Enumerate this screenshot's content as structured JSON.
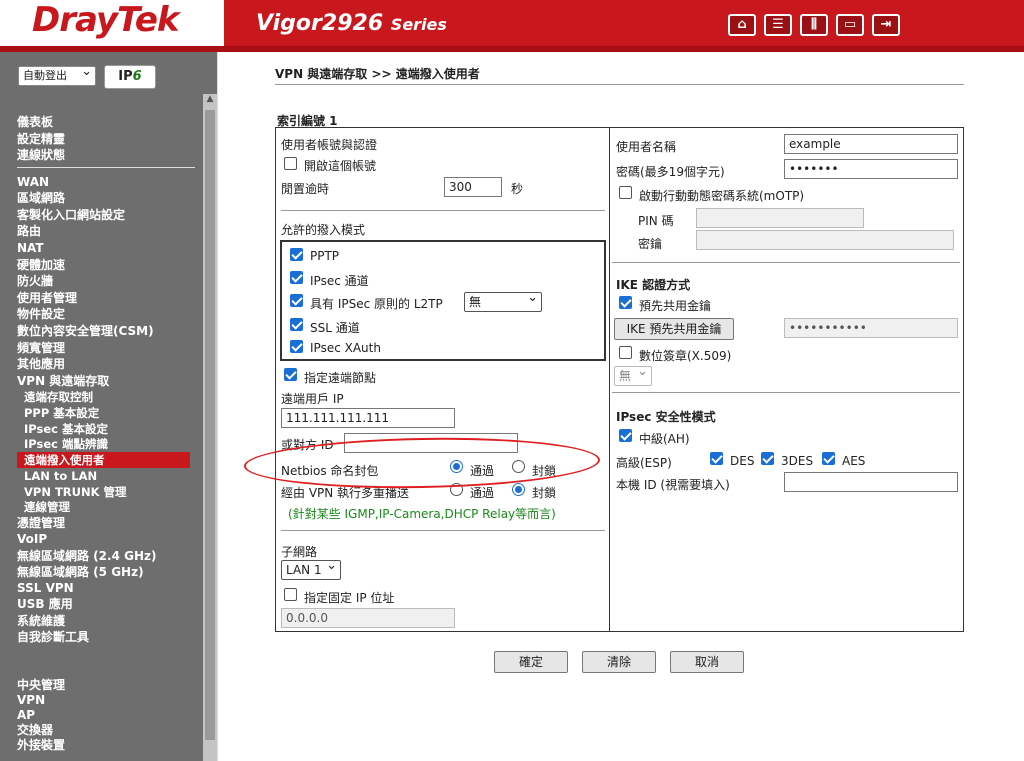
{
  "header": {
    "logo": "DrayTek",
    "model_main": "Vigor2926",
    "model_suffix": "Series",
    "icons": [
      "home-icon",
      "list-icon",
      "sliders-icon",
      "save-icon",
      "logout-icon"
    ]
  },
  "sidebar": {
    "logout_select": "自動登出",
    "ipv6_badge_prefix": "IP",
    "ipv6_badge_suffix": "6",
    "group1": [
      "儀表板",
      "設定精靈",
      "連線狀態"
    ],
    "group2": [
      "WAN",
      "區域網路",
      "客製化入口網站設定",
      "路由",
      "NAT",
      "硬體加速",
      "防火牆",
      "使用者管理",
      "物件設定",
      "數位內容安全管理(CSM)",
      "頻寬管理",
      "其他應用",
      "VPN 與遠端存取"
    ],
    "vpn_sub": [
      "遠端存取控制",
      "PPP 基本設定",
      "IPsec 基本設定",
      "IPsec 端點辨識",
      "遠端撥入使用者",
      "LAN to LAN",
      "VPN TRUNK 管理",
      "連線管理"
    ],
    "group3": [
      "憑證管理",
      "VoIP",
      "無線區域網路 (2.4 GHz)",
      "無線區域網路 (5 GHz)",
      "SSL VPN",
      "USB 應用",
      "系統維護",
      "自我診斷工具"
    ],
    "group4": [
      "中央管理",
      "VPN",
      "AP",
      "交換器",
      "外接裝置"
    ]
  },
  "breadcrumb": "VPN 與遠端存取 >> 遠端撥入使用者",
  "index_title": "索引編號 1",
  "left": {
    "account_section": "使用者帳號與認證",
    "enable_account": "開啟這個帳號",
    "idle_timeout_label": "閒置逾時",
    "idle_timeout_value": "300",
    "idle_timeout_unit": "秒",
    "allowed_modes_title": "允許的撥入模式",
    "mode_pptp": "PPTP",
    "mode_ipsec": "IPsec 通道",
    "mode_l2tp": "具有 IPSec 原則的 L2TP",
    "l2tp_policy": "無",
    "mode_ssl": "SSL 通道",
    "mode_xauth": "IPsec XAuth",
    "specify_remote_node": "指定遠端節點",
    "remote_client_ip_label": "遠端用戶 IP",
    "remote_client_ip_value": "111.111.111.111",
    "peer_id_label": "或對方 ID",
    "peer_id_value": "",
    "netbios_label": "Netbios 命名封包",
    "multicast_label": "經由 VPN 執行多重播送",
    "pass": "通過",
    "block": "封鎖",
    "multicast_hint": "(針對某些 IGMP,IP-Camera,DHCP Relay等而言)",
    "subnet_title": "子網路",
    "subnet_value": "LAN 1",
    "fixed_ip_label": "指定固定 IP 位址",
    "fixed_ip_value": "0.0.0.0"
  },
  "right": {
    "username_label": "使用者名稱",
    "username_value": "example",
    "password_label": "密碼(最多19個字元)",
    "password_value": "•••••••",
    "motp_label": "啟動行動動態密碼系統(mOTP)",
    "pin_label": "PIN 碼",
    "secret_label": "密鑰",
    "ike_title": "IKE 認證方式",
    "psk_label": "預先共用金鑰",
    "ike_psk_button": "IKE 預先共用金鑰",
    "psk_value": "•••••••••••",
    "cert_label": "數位簽章(X.509)",
    "cert_select": "無",
    "ipsec_title": "IPsec 安全性模式",
    "ah_label": "中級(AH)",
    "esp_label": "高級(ESP)",
    "des": "DES",
    "des3": "3DES",
    "aes": "AES",
    "local_id_label": "本機 ID (視需要填入)",
    "local_id_value": ""
  },
  "buttons": {
    "ok": "確定",
    "clear": "清除",
    "cancel": "取消"
  },
  "colors": {
    "brand_red": "#c8171d",
    "sidebar_gray": "#6e6e6e",
    "hint_green": "#1a8a1a",
    "annotation_red": "#e02020"
  }
}
